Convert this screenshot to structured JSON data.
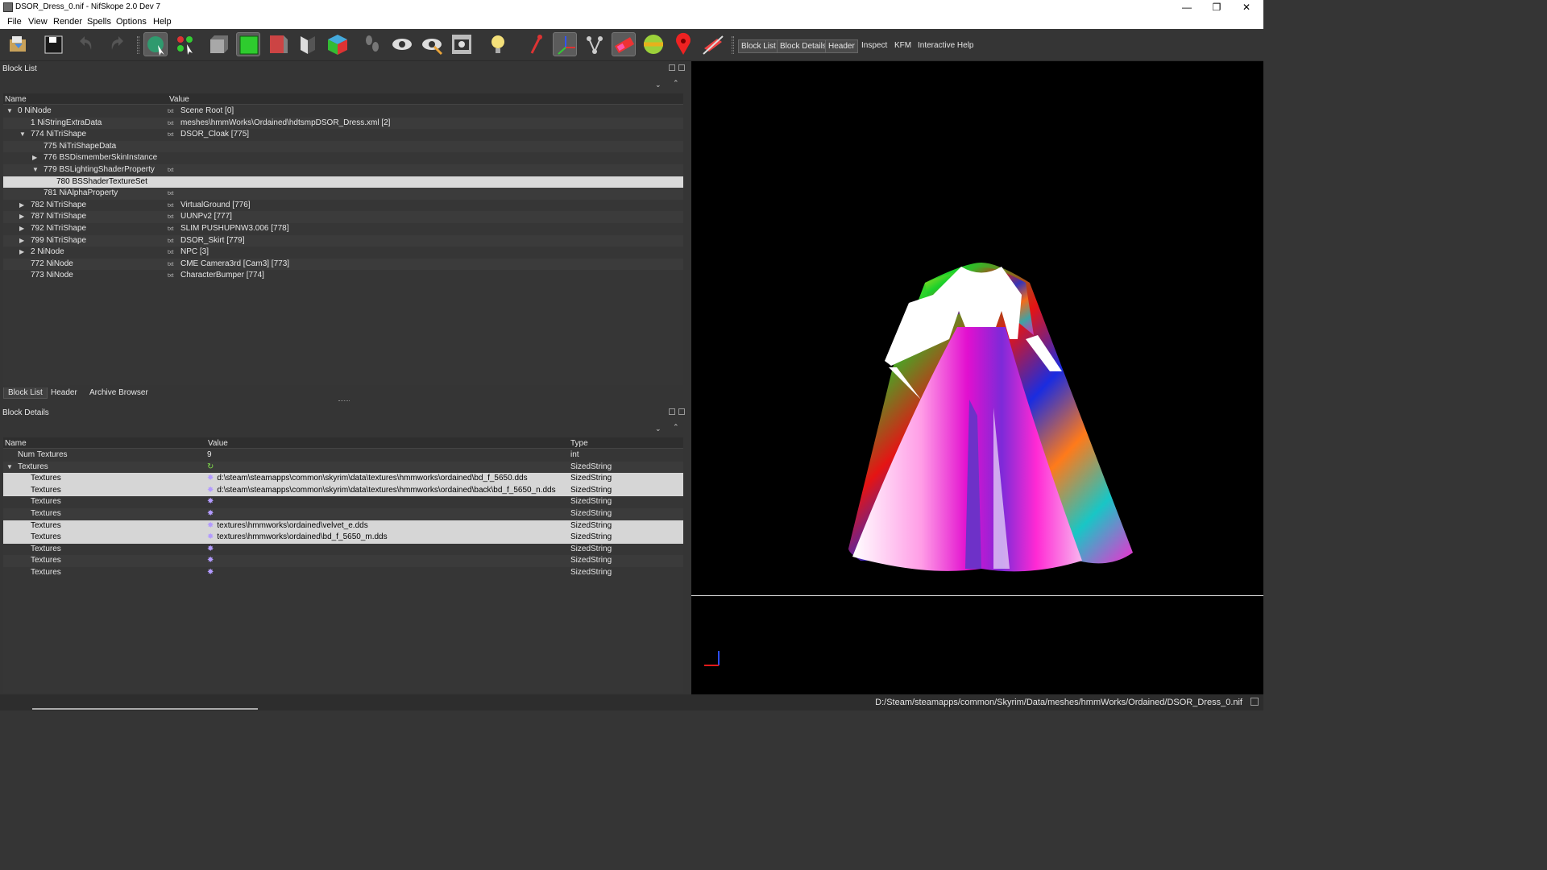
{
  "window": {
    "title": "DSOR_Dress_0.nif - NifSkope 2.0 Dev 7",
    "min_icon": "minimize-icon",
    "max_icon": "restore-icon",
    "close_icon": "close-icon"
  },
  "menu": [
    "File",
    "View",
    "Render",
    "Spells",
    "Options",
    "Help"
  ],
  "toolbar": {
    "icons": [
      "load-icon",
      "save-icon",
      "undo-icon",
      "redo-icon",
      "select-object-icon",
      "select-vertex-icon",
      "view-front-icon",
      "view-side-icon",
      "view-back-icon",
      "view-flip-icon",
      "view-perspective-icon",
      "walk-icon",
      "show-hidden-icon",
      "show-nodes-icon",
      "screenshot-icon",
      "lighting-icon",
      "show-axes-icon",
      "show-constraints-icon",
      "show-havok-icon",
      "show-furniture-icon",
      "textures-icon",
      "glow-icon",
      "marker-icon",
      "hide-icon"
    ],
    "text_buttons": [
      "Block List",
      "Block Details",
      "Header",
      "Inspect",
      "KFM",
      "Interactive Help"
    ]
  },
  "block_list": {
    "title": "Block List",
    "columns": [
      "Name",
      "Value"
    ],
    "rows": [
      {
        "name": "0 NiNode",
        "value": "Scene Root [0]",
        "indent": 0,
        "arrow": "down",
        "icon": true
      },
      {
        "name": "1 NiStringExtraData",
        "value": "meshes\\hmmWorks\\Ordained\\hdtsmpDSOR_Dress.xml [2]",
        "indent": 1,
        "arrow": "",
        "icon": true
      },
      {
        "name": "774 NiTriShape",
        "value": "DSOR_Cloak [775]",
        "indent": 1,
        "arrow": "down",
        "icon": true
      },
      {
        "name": "775 NiTriShapeData",
        "value": "",
        "indent": 2,
        "arrow": "",
        "icon": false
      },
      {
        "name": "776 BSDismemberSkinInstance",
        "value": "",
        "indent": 2,
        "arrow": "right",
        "icon": false
      },
      {
        "name": "779 BSLightingShaderProperty",
        "value": "",
        "indent": 2,
        "arrow": "down",
        "icon": true
      },
      {
        "name": "780 BSShaderTextureSet",
        "value": "",
        "indent": 3,
        "arrow": "",
        "icon": false,
        "selected": true
      },
      {
        "name": "781 NiAlphaProperty",
        "value": "",
        "indent": 2,
        "arrow": "",
        "icon": true
      },
      {
        "name": "782 NiTriShape",
        "value": "VirtualGround [776]",
        "indent": 1,
        "arrow": "right",
        "icon": true
      },
      {
        "name": "787 NiTriShape",
        "value": "UUNPv2 [777]",
        "indent": 1,
        "arrow": "right",
        "icon": true
      },
      {
        "name": "792 NiTriShape",
        "value": "SLIM PUSHUPNW3.006 [778]",
        "indent": 1,
        "arrow": "right",
        "icon": true
      },
      {
        "name": "799 NiTriShape",
        "value": "DSOR_Skirt [779]",
        "indent": 1,
        "arrow": "right",
        "icon": true
      },
      {
        "name": "2 NiNode",
        "value": "NPC [3]",
        "indent": 1,
        "arrow": "right",
        "icon": true
      },
      {
        "name": "772 NiNode",
        "value": "CME Camera3rd [Cam3] [773]",
        "indent": 1,
        "arrow": "",
        "icon": true
      },
      {
        "name": "773 NiNode",
        "value": "CharacterBumper [774]",
        "indent": 1,
        "arrow": "",
        "icon": true
      }
    ]
  },
  "tabs": [
    "Block List",
    "Header",
    "Archive Browser"
  ],
  "block_details": {
    "title": "Block Details",
    "columns": [
      "Name",
      "Value",
      "Type"
    ],
    "rows": [
      {
        "name": "Num Textures",
        "value": "9",
        "type": "int",
        "indent": 1,
        "arrow": "",
        "icon": ""
      },
      {
        "name": "Textures",
        "value": "",
        "type": "SizedString",
        "indent": 1,
        "arrow": "down",
        "icon": "refresh"
      },
      {
        "name": "Textures",
        "value": "d:\\steam\\steamapps\\common\\skyrim\\data\\textures\\hmmworks\\ordained\\bd_f_5650.dds",
        "type": "SizedString",
        "indent": 2,
        "arrow": "",
        "icon": "star",
        "hl": true
      },
      {
        "name": "Textures",
        "value": "d:\\steam\\steamapps\\common\\skyrim\\data\\textures\\hmmworks\\ordained\\back\\bd_f_5650_n.dds",
        "type": "SizedString",
        "indent": 2,
        "arrow": "",
        "icon": "star",
        "hl": true
      },
      {
        "name": "Textures",
        "value": "",
        "type": "SizedString",
        "indent": 2,
        "arrow": "",
        "icon": "star"
      },
      {
        "name": "Textures",
        "value": "",
        "type": "SizedString",
        "indent": 2,
        "arrow": "",
        "icon": "star"
      },
      {
        "name": "Textures",
        "value": "textures\\hmmworks\\ordained\\velvet_e.dds",
        "type": "SizedString",
        "indent": 2,
        "arrow": "",
        "icon": "star",
        "hl": true
      },
      {
        "name": "Textures",
        "value": "textures\\hmmworks\\ordained\\bd_f_5650_m.dds",
        "type": "SizedString",
        "indent": 2,
        "arrow": "",
        "icon": "star",
        "hl": true
      },
      {
        "name": "Textures",
        "value": "",
        "type": "SizedString",
        "indent": 2,
        "arrow": "",
        "icon": "star"
      },
      {
        "name": "Textures",
        "value": "",
        "type": "SizedString",
        "indent": 2,
        "arrow": "",
        "icon": "star"
      },
      {
        "name": "Textures",
        "value": "",
        "type": "SizedString",
        "indent": 2,
        "arrow": "",
        "icon": "star"
      }
    ]
  },
  "status": {
    "path": "D:/Steam/steamapps/common/Skyrim/Data/meshes/hmmWorks/Ordained/DSOR_Dress_0.nif"
  }
}
